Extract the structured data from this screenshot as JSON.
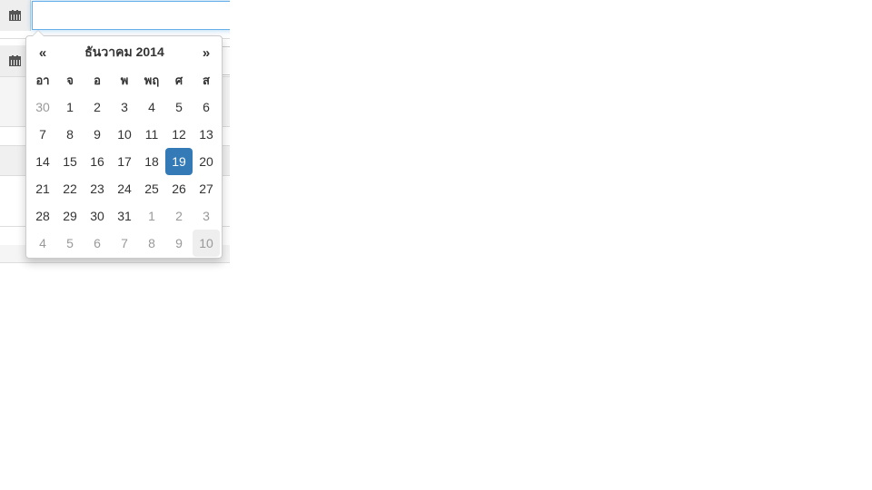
{
  "form": {
    "date_input_value": "",
    "icons": [
      "calendar-icon",
      "calendar-icon"
    ]
  },
  "datepicker": {
    "prev_label": "«",
    "next_label": "»",
    "month_title": "ธันวาคม 2014",
    "weekdays": [
      "อา",
      "จ",
      "อ",
      "พ",
      "พฤ",
      "ศ",
      "ส"
    ],
    "weeks": [
      [
        "30",
        "1",
        "2",
        "3",
        "4",
        "5",
        "6"
      ],
      [
        "7",
        "8",
        "9",
        "10",
        "11",
        "12",
        "13"
      ],
      [
        "14",
        "15",
        "16",
        "17",
        "18",
        "19",
        "20"
      ],
      [
        "21",
        "22",
        "23",
        "24",
        "25",
        "26",
        "27"
      ],
      [
        "28",
        "29",
        "30",
        "31",
        "1",
        "2",
        "3"
      ],
      [
        "4",
        "5",
        "6",
        "7",
        "8",
        "9",
        "10"
      ]
    ],
    "selected_day": "19",
    "colors": {
      "selected_bg": "#337ab7",
      "muted_text": "#999999",
      "hover_bg": "#eeeeee"
    }
  }
}
